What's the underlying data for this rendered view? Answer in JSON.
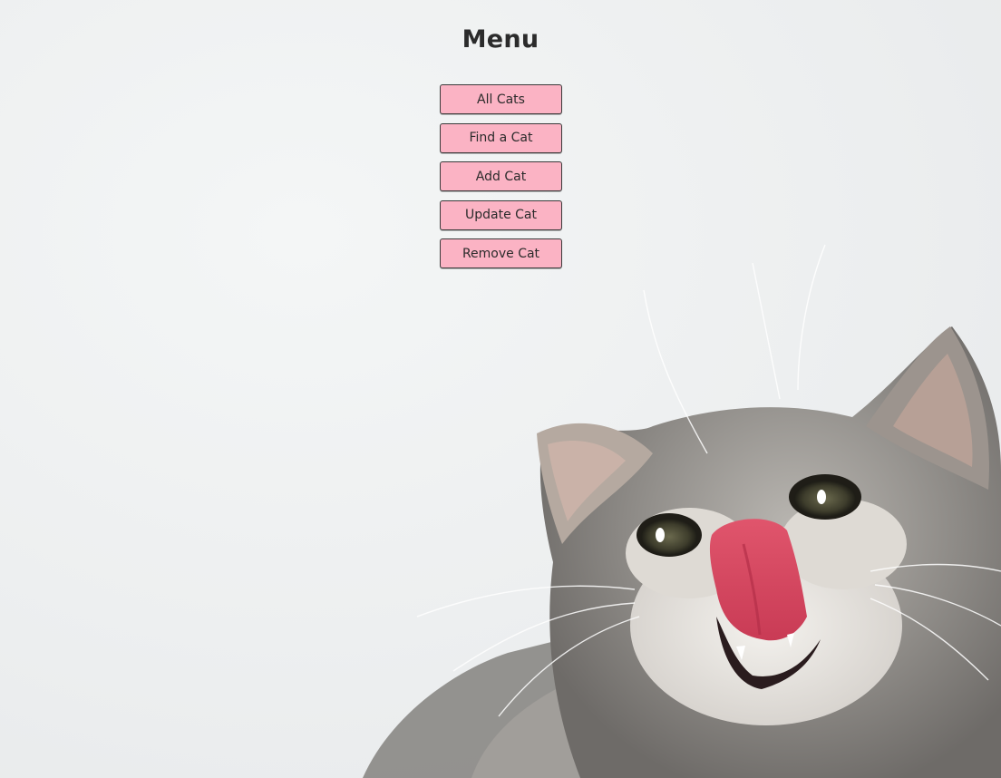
{
  "menu": {
    "title": "Menu",
    "buttons": [
      {
        "label": "All Cats"
      },
      {
        "label": "Find a Cat"
      },
      {
        "label": "Add Cat"
      },
      {
        "label": "Update Cat"
      },
      {
        "label": "Remove Cat"
      }
    ],
    "button_color": "#fbb3c4"
  },
  "background": {
    "image": "kitten-photo"
  }
}
